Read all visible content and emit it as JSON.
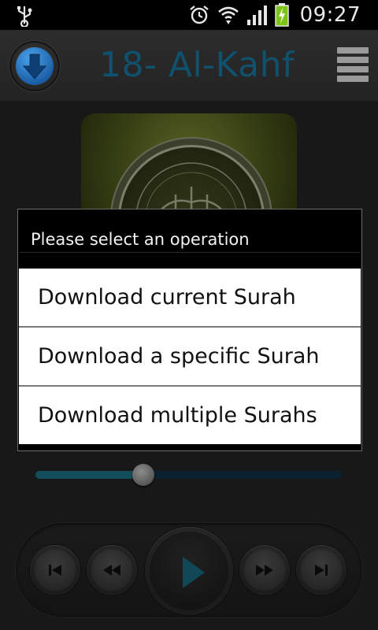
{
  "status_bar": {
    "time": "09:27",
    "icons": [
      "usb-icon",
      "alarm-icon",
      "wifi-icon",
      "signal-icon",
      "battery-charging-icon"
    ]
  },
  "header": {
    "title": "18- Al-Kahf",
    "download_icon": "download-arrow-icon",
    "menu_icon": "menu-icon"
  },
  "dialog": {
    "title": "Please select an operation",
    "options": [
      "Download current Surah",
      "Download a specific Surah",
      "Download multiple Surahs"
    ]
  },
  "player": {
    "seek_progress": 0.35,
    "buttons": [
      "skip-previous-icon",
      "rewind-icon",
      "play-icon",
      "fast-forward-icon",
      "skip-next-icon"
    ]
  },
  "colors": {
    "accent": "#1a6f86",
    "title": "#10516e",
    "download_blue": "#2a7fd0"
  }
}
